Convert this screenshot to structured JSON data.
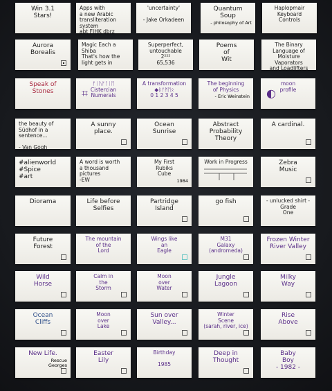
{
  "cards": [
    {
      "text": "Win 3.1\nStars!",
      "style": "big"
    },
    {
      "text": "Apps with\na new Arabic\ntransliteration\nsystem\nabt FJHK dbrz",
      "style": "left"
    },
    {
      "text": "'uncertainty'\n\n- Jake Orkadeen",
      "style": ""
    },
    {
      "text": "Quantum\nSoup",
      "sub": "- philosophy of Art",
      "style": "big"
    },
    {
      "text": "Haplopmair\nKeyboard\nControls",
      "style": ""
    },
    {
      "text": "Aurora\nBorealis",
      "style": "big",
      "box": true,
      "filled": true
    },
    {
      "text": "Magic Each a Shiba\nThat's how the\nlight gets in",
      "style": "left"
    },
    {
      "text": "Superperfect, untouchable\n2²²²\n65,536",
      "style": ""
    },
    {
      "text": "Poems\nof\nWit",
      "style": "big"
    },
    {
      "text": "The Binary\nLanguage of\nMoisture Vaporators\nand Loadlifters",
      "style": ""
    },
    {
      "text": "Speak of\nStones",
      "style": "big red"
    },
    {
      "text": "ᚠᛁᚢᚠᛚᛁᛖ\nCistercian\nNumerals",
      "style": "purple",
      "glyph": "⌗"
    },
    {
      "text": "A transformation\n◆ᛒᚠᛗᛖᛟ\n0 1 2 3 4 5",
      "style": "purple"
    },
    {
      "text": "The beginning\nof Physics",
      "sub": "- Eric Weinstein",
      "style": "purple"
    },
    {
      "text": "moon\nprofile",
      "style": "purple",
      "glyph": "◐"
    },
    {
      "text": "the beauty of\nSüdhof in a sentence...\n\n- Van Gogh",
      "style": "left"
    },
    {
      "text": "A sunny\nplace.",
      "style": "big",
      "box": true
    },
    {
      "text": "Ocean\nSunrise",
      "style": "big",
      "box": true
    },
    {
      "text": "Abstract\nProbability\nTheory",
      "style": "big"
    },
    {
      "text": "A cardinal.",
      "style": "big",
      "box": true
    },
    {
      "text": "#alienworld\n#Spice\n#art",
      "style": "big left"
    },
    {
      "text": "A word is worth\na thousand\npictures\n-EW",
      "style": "left"
    },
    {
      "text": "My First\nRubiks\nCube",
      "sub": "1984",
      "style": ""
    },
    {
      "text": "Work in Progress",
      "style": "sketch"
    },
    {
      "text": "Zebra\nMusic",
      "style": "big",
      "box": true
    },
    {
      "text": "Diorama",
      "style": "big"
    },
    {
      "text": "Life before\nSelfies",
      "style": "big"
    },
    {
      "text": "Partridge\nIsland",
      "style": "big",
      "box": true
    },
    {
      "text": "go fish",
      "style": "big",
      "box": true
    },
    {
      "text": "- unlucked shirt -\nGrade\nOne",
      "style": ""
    },
    {
      "text": "Future\nForest",
      "style": "big",
      "box": true
    },
    {
      "text": "The mountain\nof the\nLord",
      "style": "purple"
    },
    {
      "text": "Wings like\nan\nEagle",
      "style": "purple",
      "box": true,
      "boxColor": "#68c6c4"
    },
    {
      "text": "M31\nGalaxy\n(andromeda)",
      "style": "purple",
      "box": true
    },
    {
      "text": "Frozen Winter\nRiver Valley",
      "style": "purple big",
      "box": true
    },
    {
      "text": "Wild\nHorse",
      "style": "purple big",
      "box": true
    },
    {
      "text": "Calm in\nthe\nStorm",
      "style": "purple",
      "box": true
    },
    {
      "text": "Moon\nover\nWater",
      "style": "purple",
      "box": true
    },
    {
      "text": "Jungle\nLagoon",
      "style": "purple big",
      "box": true
    },
    {
      "text": "Milky\nWay",
      "style": "purple big",
      "box": true
    },
    {
      "text": "Ocean\nCliffs",
      "style": "blue big",
      "box": true
    },
    {
      "text": "Moon\nover\nLake",
      "style": "purple",
      "box": true
    },
    {
      "text": "Sun over\nValley...",
      "style": "purple big",
      "box": true
    },
    {
      "text": "Winter\nScene\n(sarah, river, ice)",
      "style": "purple",
      "box": true
    },
    {
      "text": "Rise\nAbove",
      "style": "purple big",
      "box": true
    },
    {
      "text": "New Life.",
      "sub": "Rescue\nGeorges",
      "style": "purple big",
      "box": true
    },
    {
      "text": "Easter\nLily",
      "style": "purple big",
      "box": true
    },
    {
      "text": "Birthday\n\n1985",
      "style": "purple"
    },
    {
      "text": "Deep in\nThought",
      "style": "purple big",
      "box": true
    },
    {
      "text": "Baby\nBoy\n- 1982 -",
      "style": "purple big"
    }
  ]
}
